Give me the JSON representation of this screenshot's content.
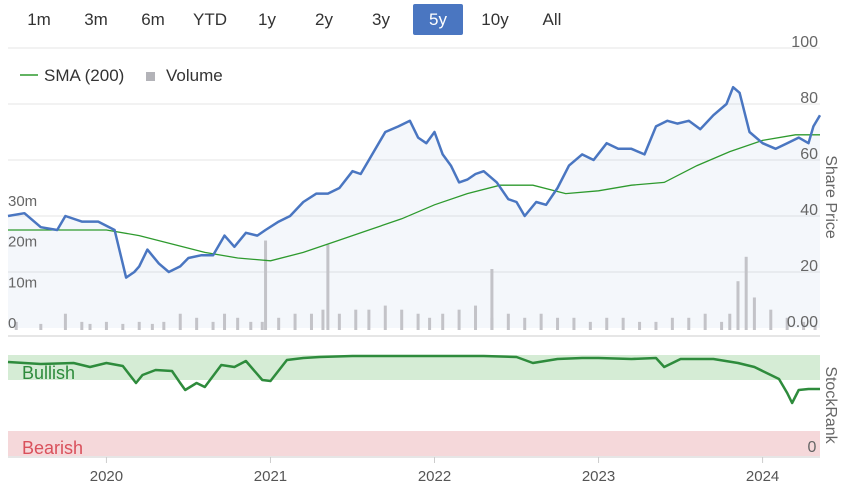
{
  "range_selector": {
    "buttons": [
      "1m",
      "3m",
      "6m",
      "YTD",
      "1y",
      "2y",
      "3y",
      "5y",
      "10y",
      "All"
    ],
    "active": "5y"
  },
  "colors": {
    "price": "#4a76c1",
    "sma": "#2e9a2e",
    "volume": "#c3c3c8",
    "bullish_band": "#d5ecd5",
    "bearish_band": "#f5d8da",
    "rank_line": "#2e8b3c",
    "rank_line_dim": "#9a9a9a",
    "bullish_text": "#2e8b3c",
    "bearish_text": "#d9505b"
  },
  "chart_data": [
    {
      "type": "line",
      "legend": [
        "SMA (200)",
        "Volume"
      ],
      "y_right_title": "Share Price",
      "y_right_ticks": [
        "0.00",
        "20",
        "40",
        "60",
        "80",
        "100"
      ],
      "y_right_lim": [
        0,
        100
      ],
      "y_left_ticks": [
        "0",
        "10m",
        "20m",
        "30m"
      ],
      "y_left_lim": [
        0,
        30
      ],
      "x_ticks": [
        "2020",
        "2021",
        "2022",
        "2023",
        "2024"
      ],
      "x_lim": [
        2019.4,
        2024.35
      ],
      "grid": true,
      "legend_position": "top-left",
      "series": [
        {
          "name": "Price",
          "x": [
            2019.4,
            2019.5,
            2019.6,
            2019.7,
            2019.75,
            2019.85,
            2019.95,
            2020.05,
            2020.12,
            2020.17,
            2020.2,
            2020.25,
            2020.32,
            2020.38,
            2020.45,
            2020.5,
            2020.58,
            2020.65,
            2020.72,
            2020.78,
            2020.85,
            2020.92,
            2020.97,
            2021.05,
            2021.12,
            2021.2,
            2021.28,
            2021.35,
            2021.42,
            2021.5,
            2021.55,
            2021.62,
            2021.7,
            2021.78,
            2021.85,
            2021.9,
            2021.95,
            2022.0,
            2022.05,
            2022.1,
            2022.15,
            2022.2,
            2022.25,
            2022.3,
            2022.38,
            2022.45,
            2022.5,
            2022.55,
            2022.62,
            2022.68,
            2022.75,
            2022.82,
            2022.9,
            2022.97,
            2023.05,
            2023.12,
            2023.2,
            2023.28,
            2023.35,
            2023.42,
            2023.48,
            2023.55,
            2023.62,
            2023.7,
            2023.78,
            2023.82,
            2023.86,
            2023.92,
            2024.0,
            2024.08,
            2024.15,
            2024.22,
            2024.28,
            2024.31,
            2024.35
          ],
          "values": [
            40,
            41,
            36,
            35,
            40,
            38,
            38,
            35,
            18,
            20,
            22,
            28,
            23,
            20,
            22,
            25,
            26,
            26,
            33,
            29,
            34,
            33,
            35,
            38,
            40,
            45,
            48,
            48,
            50,
            56,
            55,
            62,
            70,
            72,
            74,
            68,
            66,
            70,
            62,
            58,
            52,
            53,
            55,
            56,
            52,
            46,
            45,
            40,
            45,
            44,
            50,
            58,
            62,
            60,
            66,
            64,
            64,
            62,
            72,
            74,
            73,
            74,
            71,
            76,
            80,
            86,
            84,
            70,
            66,
            64,
            66,
            68,
            66,
            72,
            76
          ]
        },
        {
          "name": "SMA (200)",
          "x": [
            2019.4,
            2019.6,
            2019.8,
            2020.0,
            2020.2,
            2020.4,
            2020.6,
            2020.8,
            2021.0,
            2021.2,
            2021.4,
            2021.6,
            2021.8,
            2022.0,
            2022.2,
            2022.4,
            2022.6,
            2022.8,
            2023.0,
            2023.2,
            2023.4,
            2023.6,
            2023.8,
            2024.0,
            2024.2,
            2024.35
          ],
          "values": [
            35,
            35,
            35,
            35,
            33,
            30,
            27,
            25,
            24,
            27,
            31,
            35,
            39,
            44,
            48,
            51,
            51,
            48,
            49,
            51,
            52,
            58,
            63,
            67,
            69,
            69
          ]
        },
        {
          "name": "Volume",
          "x": [
            2019.45,
            2019.6,
            2019.75,
            2019.85,
            2019.9,
            2020.0,
            2020.1,
            2020.2,
            2020.28,
            2020.35,
            2020.45,
            2020.55,
            2020.65,
            2020.72,
            2020.8,
            2020.88,
            2020.95,
            2020.97,
            2021.05,
            2021.15,
            2021.25,
            2021.32,
            2021.35,
            2021.42,
            2021.52,
            2021.6,
            2021.7,
            2021.8,
            2021.9,
            2021.97,
            2022.05,
            2022.15,
            2022.25,
            2022.35,
            2022.35,
            2022.45,
            2022.55,
            2022.65,
            2022.75,
            2022.85,
            2022.95,
            2023.05,
            2023.15,
            2023.25,
            2023.35,
            2023.45,
            2023.55,
            2023.65,
            2023.75,
            2023.8,
            2023.85,
            2023.9,
            2023.95,
            2024.05,
            2024.15,
            2024.25,
            2024.32
          ],
          "values": [
            2,
            1.5,
            4,
            2,
            1.5,
            2,
            1.5,
            2,
            1.5,
            2,
            4,
            3,
            2,
            4,
            3,
            2,
            2,
            22,
            3,
            4,
            4,
            5,
            21,
            4,
            5,
            5,
            6,
            5,
            4,
            3,
            4,
            5,
            6,
            3,
            15,
            4,
            3,
            4,
            3,
            3,
            2,
            3,
            3,
            2,
            2,
            3,
            3,
            4,
            2,
            4,
            12,
            18,
            8,
            5,
            3,
            2,
            1
          ]
        }
      ]
    },
    {
      "type": "line",
      "y_right_title": "StockRank",
      "y_right_ticks": [
        "0"
      ],
      "bands": [
        "Bullish",
        "Bearish"
      ],
      "series": [
        {
          "name": "StockRank",
          "x": [
            2019.4,
            2019.6,
            2019.8,
            2019.9,
            2020.0,
            2020.1,
            2020.18,
            2020.22,
            2020.3,
            2020.4,
            2020.45,
            2020.48,
            2020.55,
            2020.6,
            2020.7,
            2020.78,
            2020.85,
            2020.95,
            2021.0,
            2021.1,
            2021.2,
            2021.3,
            2021.5,
            2021.8,
            2022.0,
            2022.3,
            2022.5,
            2022.6,
            2022.75,
            2022.9,
            2023.0,
            2023.2,
            2023.35,
            2023.4,
            2023.5,
            2023.7,
            2023.85,
            2023.95,
            2024.05,
            2024.1,
            2024.15,
            2024.18,
            2024.22,
            2024.28,
            2024.35
          ],
          "values": [
            93,
            91,
            92,
            88,
            92,
            89,
            72,
            80,
            85,
            84,
            72,
            65,
            72,
            68,
            90,
            88,
            94,
            75,
            74,
            95,
            97,
            98,
            99,
            99,
            99,
            99,
            98,
            92,
            96,
            97,
            97,
            96,
            97,
            88,
            96,
            96,
            92,
            88,
            80,
            76,
            62,
            52,
            65,
            66,
            66
          ]
        }
      ]
    }
  ]
}
